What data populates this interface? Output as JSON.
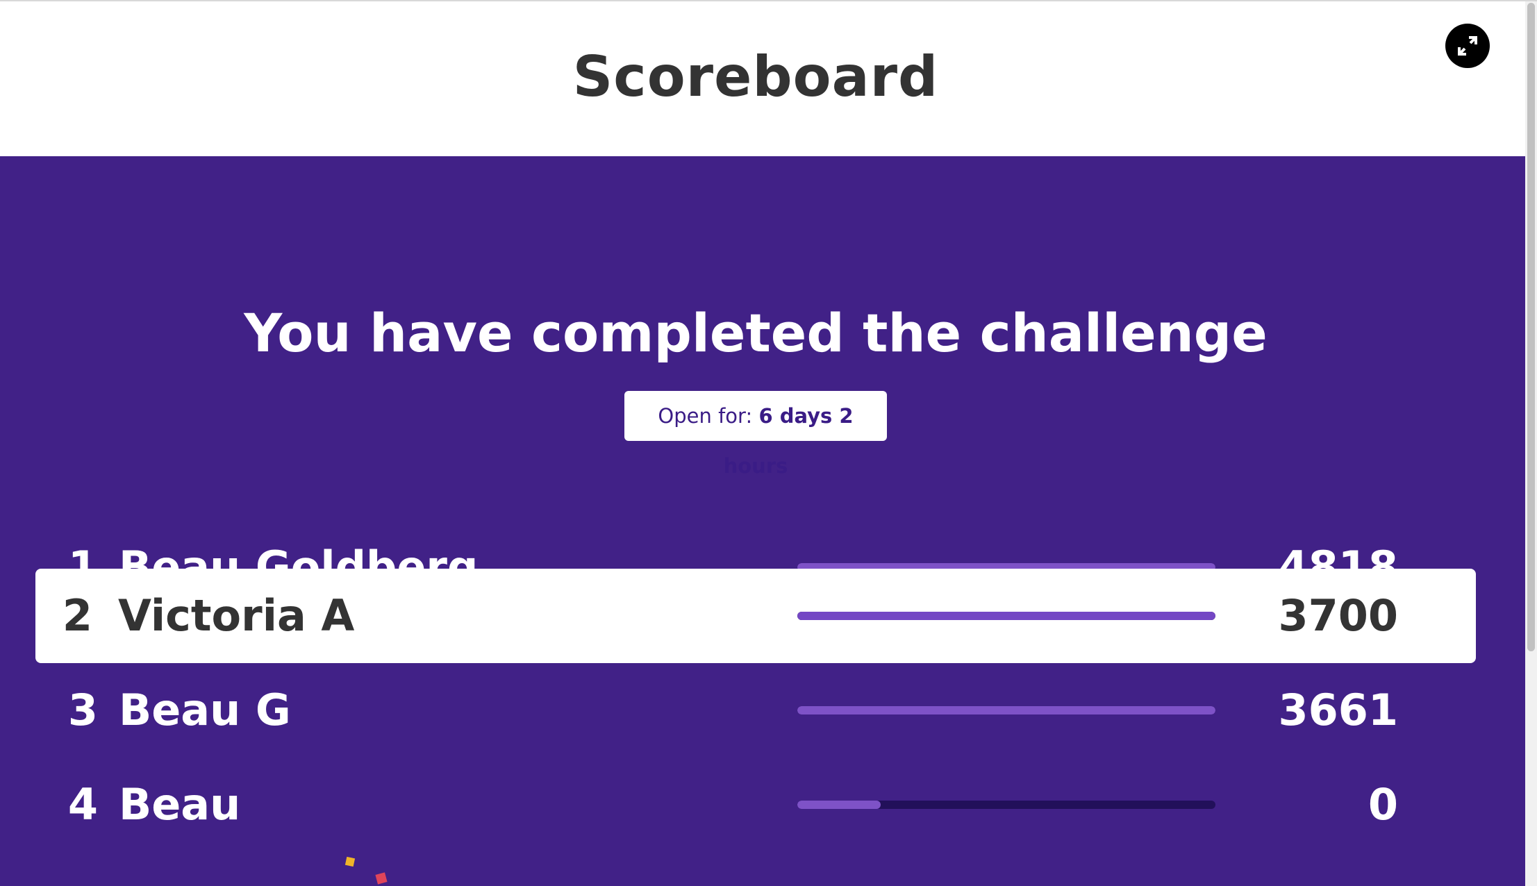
{
  "header": {
    "title": "Scoreboard",
    "fullscreen_icon": "expand-icon"
  },
  "main": {
    "headline": "You have completed the challenge",
    "timer": {
      "label": "Open for:",
      "value": "6 days 2 hours"
    },
    "leaderboard": [
      {
        "rank": "1",
        "name": "Beau Goldberg",
        "score": "4818",
        "progress": 1.0,
        "current_user": false
      },
      {
        "rank": "2",
        "name": "Victoria A",
        "score": "3700",
        "progress": 1.0,
        "current_user": true
      },
      {
        "rank": "3",
        "name": "Beau G",
        "score": "3661",
        "progress": 1.0,
        "current_user": false
      },
      {
        "rank": "4",
        "name": "Beau",
        "score": "0",
        "progress": 0.2,
        "current_user": false
      }
    ]
  },
  "colors": {
    "header_bg": "#ffffff",
    "main_bg": "#412187",
    "bar_fill": "#7e52c7",
    "bar_track": "#22105a",
    "text_dark": "#333333",
    "confetti": [
      "#f0b429",
      "#e0455a"
    ]
  }
}
